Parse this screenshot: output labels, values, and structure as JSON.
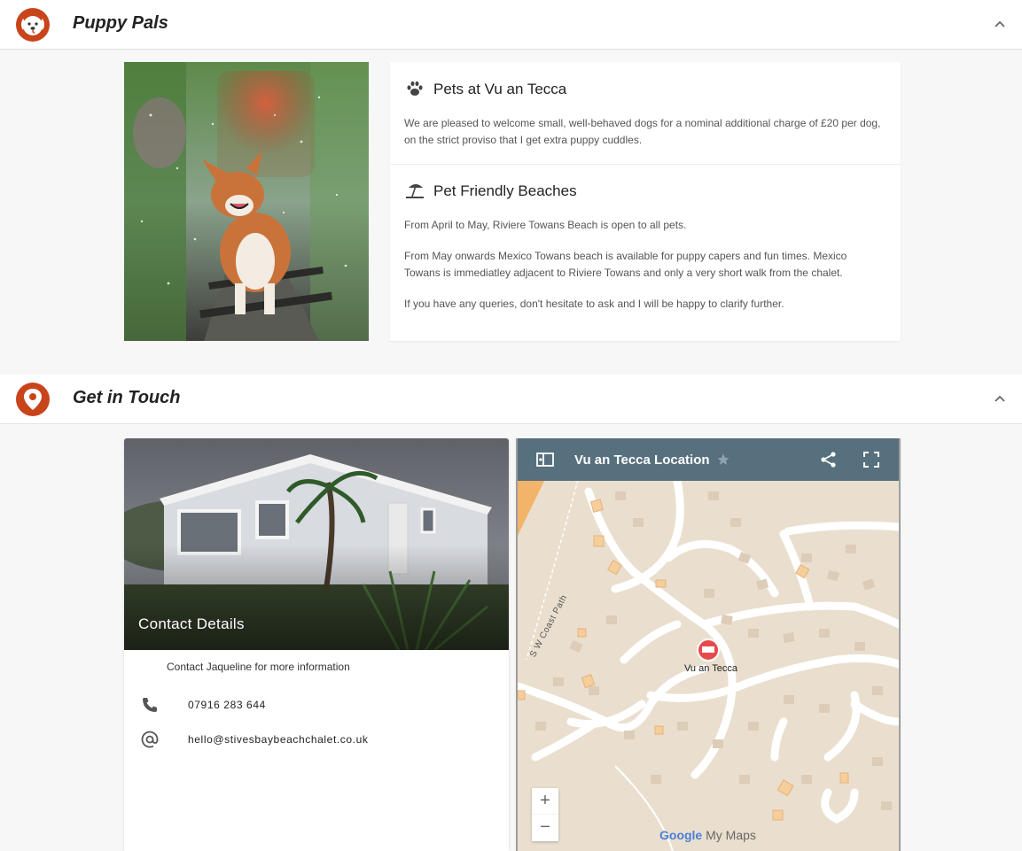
{
  "sections": {
    "puppy": {
      "title": "Puppy Pals",
      "icon": "dog-face-icon",
      "collapse_icon": "chevron-up-icon"
    },
    "contact": {
      "title": "Get in Touch",
      "icon": "location-pin-icon",
      "collapse_icon": "chevron-up-icon"
    }
  },
  "pets_card": {
    "icon": "paw-icon",
    "title": "Pets at Vu an Tecca",
    "body": "We are pleased to welcome small, well-behaved dogs for a nominal additional charge of £20 per dog, on the strict proviso that I get extra puppy cuddles."
  },
  "beach_card": {
    "icon": "beach-umbrella-icon",
    "title": "Pet Friendly Beaches",
    "paragraphs": [
      "From April to May, Riviere Towans Beach is open to all pets.",
      "From May onwards Mexico Towans beach is available for puppy capers and fun times. Mexico Towans is immediatley adjacent to Riviere Towans and only a very short walk from the chalet.",
      "If you have any queries, don't hesitate to ask and I will be happy to clarify further."
    ]
  },
  "contact_card": {
    "title": "Contact Details",
    "intro": "Contact Jaqueline for more information",
    "phone": "07916 283 644",
    "email": "hello@stivesbaybeachchalet.co.uk"
  },
  "map": {
    "title": "Vu an Tecca Location",
    "pin_label": "Vu an Tecca",
    "coast_label": "S W Coast Path",
    "zoom_in": "+",
    "zoom_out": "−",
    "logo_google": "Google",
    "logo_mymaps": "My Maps",
    "colors": {
      "bar": "#56707e",
      "land": "#eadfce",
      "pin": "#e84a4a"
    }
  },
  "colors": {
    "brand": "#c8441b"
  }
}
